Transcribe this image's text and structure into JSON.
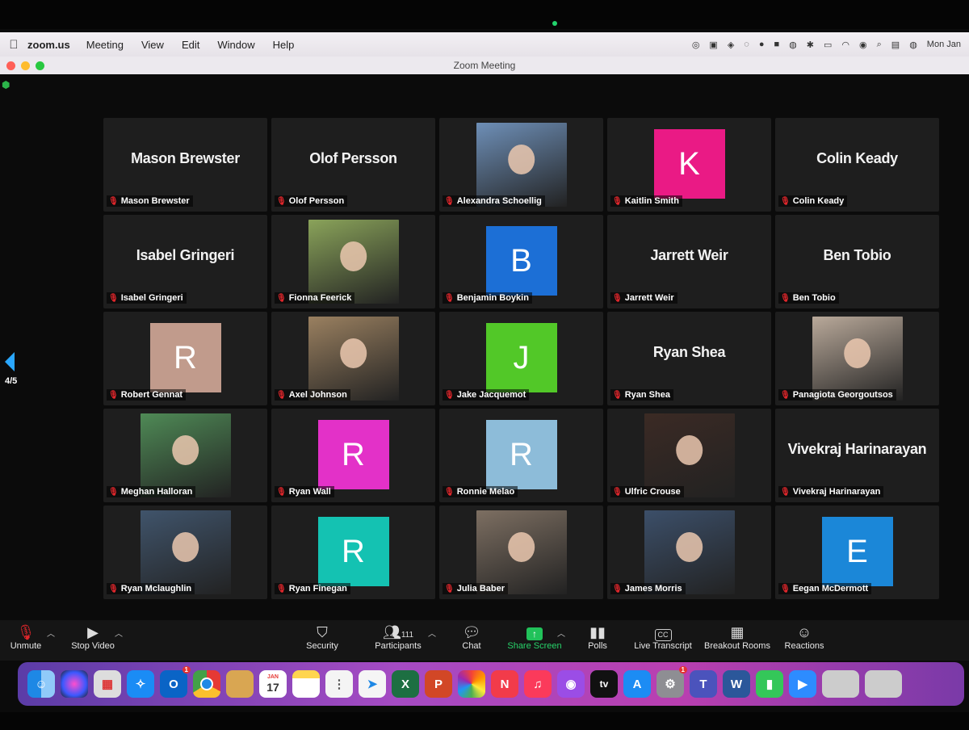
{
  "menubar": {
    "app": "zoom.us",
    "items": [
      "Meeting",
      "View",
      "Edit",
      "Window",
      "Help"
    ],
    "clock": "Mon Jan"
  },
  "window": {
    "title": "Zoom Meeting"
  },
  "pager": {
    "label": "4/5"
  },
  "participants": [
    {
      "name": "Mason Brewster",
      "kind": "text"
    },
    {
      "name": "Olof Persson",
      "kind": "text"
    },
    {
      "name": "Alexandra Schoellig",
      "kind": "photo",
      "color": "#6e8fb7"
    },
    {
      "name": "Kaitlin Smith",
      "kind": "avatar",
      "letter": "K",
      "color": "#ea1a85"
    },
    {
      "name": "Colin Keady",
      "kind": "text"
    },
    {
      "name": "Isabel Gringeri",
      "kind": "text"
    },
    {
      "name": "Fionna Feerick",
      "kind": "photo",
      "color": "#8aa35a"
    },
    {
      "name": "Benjamin Boykin",
      "kind": "avatar",
      "letter": "B",
      "color": "#1c6fd6"
    },
    {
      "name": "Jarrett Weir",
      "kind": "text"
    },
    {
      "name": "Ben Tobio",
      "kind": "text"
    },
    {
      "name": "Robert Gennat",
      "kind": "avatar",
      "letter": "R",
      "color": "#c19b8c"
    },
    {
      "name": "Axel Johnson",
      "kind": "photo",
      "color": "#9a8060"
    },
    {
      "name": "Jake Jacquemot",
      "kind": "avatar",
      "letter": "J",
      "color": "#52c828"
    },
    {
      "name": "Ryan Shea",
      "kind": "text"
    },
    {
      "name": "Panagiota Georgoutsos",
      "kind": "photo",
      "color": "#b9a99a"
    },
    {
      "name": "Meghan Halloran",
      "kind": "photo",
      "color": "#4f8a56"
    },
    {
      "name": "Ryan Wall",
      "kind": "avatar",
      "letter": "R",
      "color": "#e331c8"
    },
    {
      "name": "Ronnie Melao",
      "kind": "avatar",
      "letter": "R",
      "color": "#8dbcd9"
    },
    {
      "name": "Ulfric Crouse",
      "kind": "photo",
      "color": "#3b2a24"
    },
    {
      "name": "Vivekraj Harinarayan",
      "kind": "text"
    },
    {
      "name": "Ryan Mclaughlin",
      "kind": "photo",
      "color": "#40546b"
    },
    {
      "name": "Ryan Finegan",
      "kind": "avatar",
      "letter": "R",
      "color": "#14c2b2"
    },
    {
      "name": "Julia Baber",
      "kind": "photo",
      "color": "#7d6f62"
    },
    {
      "name": "James Morris",
      "kind": "photo",
      "color": "#3c4f69"
    },
    {
      "name": "Eegan McDermott",
      "kind": "avatar",
      "letter": "E",
      "color": "#1b87d8"
    }
  ],
  "toolbar": {
    "unmute": "Unmute",
    "stop_video": "Stop Video",
    "security": "Security",
    "participants": "Participants",
    "participants_count": "111",
    "chat": "Chat",
    "share_screen": "Share Screen",
    "polls": "Polls",
    "live_transcript": "Live Transcript",
    "cc": "CC",
    "breakout_rooms": "Breakout Rooms",
    "reactions": "Reactions"
  },
  "dock": {
    "calendar_month": "JAN",
    "calendar_day": "17",
    "outlook_badge": "1",
    "settings_badge": "1",
    "tv_label": "tv",
    "word_letter": "W",
    "excel_letter": "X",
    "powerpoint_letter": "P"
  }
}
